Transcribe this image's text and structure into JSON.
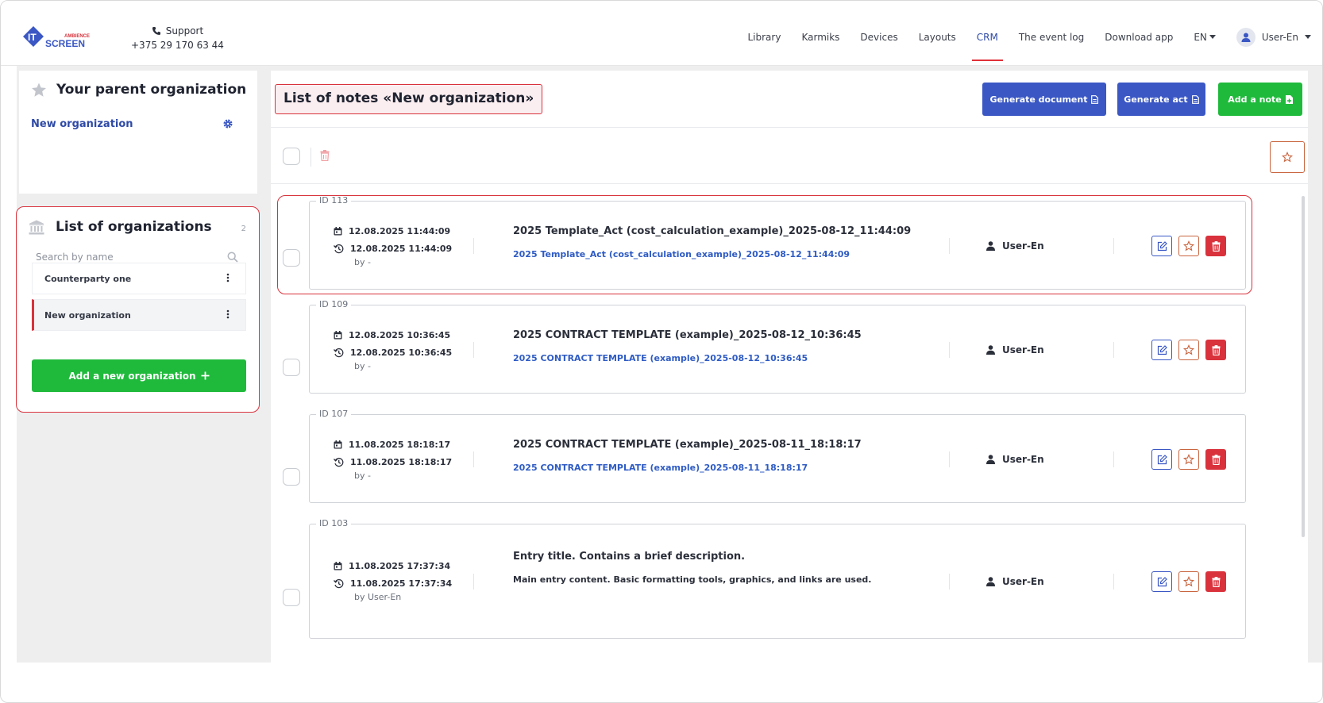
{
  "header": {
    "logo": {
      "it": "IT",
      "ambience": "AMBIENCE",
      "screen": "SCREEN"
    },
    "support": {
      "label": "Support",
      "phone": "+375 29 170 63 44"
    },
    "nav": [
      {
        "label": "Library"
      },
      {
        "label": "Karmiks"
      },
      {
        "label": "Devices"
      },
      {
        "label": "Layouts"
      },
      {
        "label": "CRM"
      },
      {
        "label": "The event log"
      },
      {
        "label": "Download app"
      }
    ],
    "lang": "EN",
    "user": "User-En"
  },
  "parent_org": {
    "title": "Your parent organization",
    "org_name": "New organization"
  },
  "org_list": {
    "title": "List of organizations",
    "count": "2",
    "search_placeholder": "Search by name",
    "items": [
      {
        "name": "Counterparty one"
      },
      {
        "name": "New organization"
      }
    ],
    "add_label": "Add a new organization"
  },
  "main": {
    "title": "List of notes «New organization»",
    "generate_document": "Generate document",
    "generate_act": "Generate act",
    "add_note": "Add a note",
    "notes": [
      {
        "id": "ID 113",
        "created": "12.08.2025 11:44:09",
        "updated": "12.08.2025 11:44:09",
        "by": "by -",
        "title": "2025 Template_Act (cost_calculation_example)_2025-08-12_11:44:09",
        "link": "2025 Template_Act (cost_calculation_example)_2025-08-12_11:44:09",
        "author": "User-En"
      },
      {
        "id": "ID 109",
        "created": "12.08.2025 10:36:45",
        "updated": "12.08.2025 10:36:45",
        "by": "by -",
        "title": "2025 CONTRACT TEMPLATE (example)_2025-08-12_10:36:45",
        "link": "2025 CONTRACT TEMPLATE (example)_2025-08-12_10:36:45",
        "author": "User-En"
      },
      {
        "id": "ID 107",
        "created": "11.08.2025 18:18:17",
        "updated": "11.08.2025 18:18:17",
        "by": "by -",
        "title": "2025 CONTRACT TEMPLATE (example)_2025-08-11_18:18:17",
        "link": "2025 CONTRACT TEMPLATE (example)_2025-08-11_18:18:17",
        "author": "User-En"
      },
      {
        "id": "ID 103",
        "created": "11.08.2025 17:37:34",
        "updated": "11.08.2025 17:37:34",
        "by": "by User-En",
        "title": "Entry title. Contains a brief description.",
        "text": "Main entry content. Basic formatting tools, graphics, and links are used.",
        "author": "User-En"
      }
    ]
  },
  "colors": {
    "accent_blue": "#3a57c4",
    "accent_green": "#1fba3b",
    "highlight_red": "#d9323c",
    "link_blue": "#2f5cc4"
  }
}
